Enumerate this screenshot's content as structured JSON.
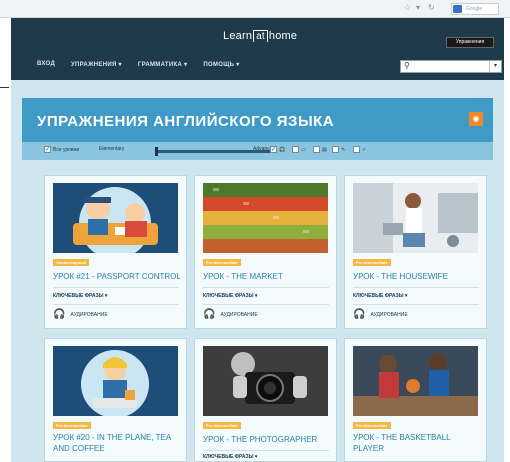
{
  "browser": {
    "search_placeholder": "Google"
  },
  "header": {
    "logo_left": "Learn",
    "logo_mid": "at",
    "logo_right": "home",
    "menu": [
      "ВХОД",
      "УПРАЖНЕНИЯ ▾",
      "ГРАММАТИКА ▾",
      "ПОМОЩЬ ▾"
    ],
    "search_tooltip": "Упражнения"
  },
  "page": {
    "title": "УПРАЖНЕНИЯ АНГЛИЙСКОГО ЯЗЫКА",
    "filters": {
      "all_levels": "Все уровни",
      "level_min": "Elementary",
      "level_max": "Advanced"
    }
  },
  "cards": [
    {
      "badge": "Элементарный",
      "title": "УРОК #21 - PASSPORT CONTROL",
      "keys": "КЛЮЧЕВЫЕ ФРАЗЫ ▾",
      "listen": "АУДИРОВАНИЕ",
      "image": "cartoon-passport-control"
    },
    {
      "badge": "Pre-Intermediate",
      "title": "УРОК - THE MARKET",
      "keys": "КЛЮЧЕВЫЕ ФРАЗЫ ▾",
      "listen": "АУДИРОВАНИЕ",
      "image": "market-produce-photo"
    },
    {
      "badge": "Pre-Intermediate",
      "title": "УРОК - THE HOUSEWIFE",
      "keys": "КЛЮЧЕВЫЕ ФРАЗЫ ▾",
      "listen": "АУДИРОВАНИЕ",
      "image": "housewife-kitchen-photo"
    },
    {
      "badge": "Pre-Intermediate",
      "title": "УРОК #20 - IN THE PLANE, TEA AND COFFEE",
      "keys": "",
      "listen": "",
      "image": "cartoon-flight-attendant"
    },
    {
      "badge": "Pre-Intermediate",
      "title": "УРОК - THE PHOTOGRAPHER",
      "keys": "КЛЮЧЕВЫЕ ФРАЗЫ ▾",
      "listen": "",
      "image": "photographer-camera-photo"
    },
    {
      "badge": "Pre-Intermediate",
      "title": "УРОК - THE BASKETBALL PLAYER",
      "keys": "",
      "listen": "",
      "image": "basketball-players-photo"
    }
  ]
}
